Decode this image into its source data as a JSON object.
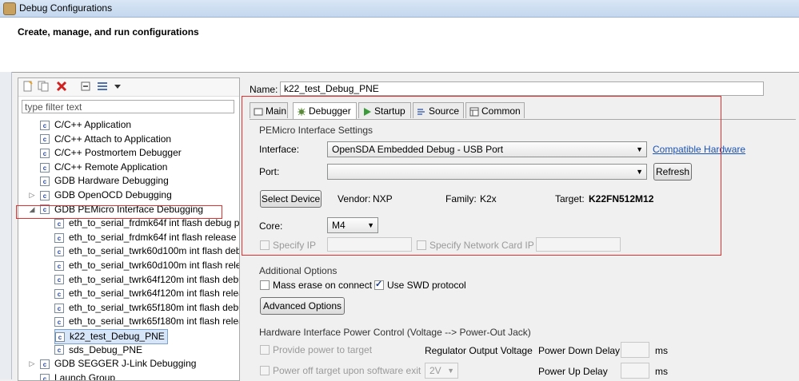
{
  "window": {
    "title": "Debug Configurations"
  },
  "header": {
    "heading": "Create, manage, and run configurations"
  },
  "sidebar": {
    "filter_placeholder": "type filter text",
    "items": [
      {
        "label": "C/C++ Application",
        "level": 0,
        "expander": ""
      },
      {
        "label": "C/C++ Attach to Application",
        "level": 0,
        "expander": ""
      },
      {
        "label": "C/C++ Postmortem Debugger",
        "level": 0,
        "expander": ""
      },
      {
        "label": "C/C++ Remote Application",
        "level": 0,
        "expander": ""
      },
      {
        "label": "GDB Hardware Debugging",
        "level": 0,
        "expander": ""
      },
      {
        "label": "GDB OpenOCD Debugging",
        "level": 0,
        "expander": "▷"
      },
      {
        "label": "GDB PEMicro Interface Debugging",
        "level": 0,
        "expander": "◢"
      },
      {
        "label": "eth_to_serial_frdmk64f int flash debug pne",
        "level": 1,
        "expander": ""
      },
      {
        "label": "eth_to_serial_frdmk64f int flash release pne",
        "level": 1,
        "expander": ""
      },
      {
        "label": "eth_to_serial_twrk60d100m int flash debug pne",
        "level": 1,
        "expander": ""
      },
      {
        "label": "eth_to_serial_twrk60d100m int flash release pne",
        "level": 1,
        "expander": ""
      },
      {
        "label": "eth_to_serial_twrk64f120m int flash debug pne",
        "level": 1,
        "expander": ""
      },
      {
        "label": "eth_to_serial_twrk64f120m int flash release pne",
        "level": 1,
        "expander": ""
      },
      {
        "label": "eth_to_serial_twrk65f180m int flash debug pne",
        "level": 1,
        "expander": ""
      },
      {
        "label": "eth_to_serial_twrk65f180m int flash release pne",
        "level": 1,
        "expander": ""
      },
      {
        "label": "k22_test_Debug_PNE",
        "level": 1,
        "expander": "",
        "selected": true
      },
      {
        "label": "sds_Debug_PNE",
        "level": 1,
        "expander": ""
      },
      {
        "label": "GDB SEGGER J-Link Debugging",
        "level": 0,
        "expander": "▷"
      },
      {
        "label": "Launch Group",
        "level": 0,
        "expander": ""
      }
    ]
  },
  "main": {
    "name_label": "Name:",
    "name_value": "k22_test_Debug_PNE",
    "tabs": [
      "Main",
      "Debugger",
      "Startup",
      "Source",
      "Common"
    ],
    "pemicro": {
      "section_title": "PEMicro Interface Settings",
      "interface_label": "Interface:",
      "interface_value": "OpenSDA Embedded Debug - USB Port",
      "compatible_link": "Compatible Hardware",
      "port_label": "Port:",
      "port_value": "",
      "refresh_label": "Refresh",
      "select_device_label": "Select Device",
      "vendor_label": "Vendor:",
      "vendor_value": "NXP",
      "family_label": "Family:",
      "family_value": "K2x",
      "target_label": "Target:",
      "target_value": "K22FN512M12",
      "core_label": "Core:",
      "core_value": "M4",
      "specify_ip_label": "Specify IP",
      "specify_network_label": "Specify Network Card IP"
    },
    "additional": {
      "section_title": "Additional Options",
      "mass_erase_label": "Mass erase on connect",
      "use_swd_label": "Use SWD protocol",
      "advanced_label": "Advanced Options"
    },
    "power": {
      "section_title": "Hardware Interface Power Control (Voltage --> Power-Out Jack)",
      "provide_power_label": "Provide power to target",
      "regulator_label": "Regulator Output Voltage",
      "power_down_label": "Power Down Delay",
      "ms1": "ms",
      "power_off_label": "Power off target upon software exit",
      "voltage_value": "2V",
      "power_up_label": "Power Up Delay",
      "ms2": "ms"
    }
  },
  "colors": {
    "annotation_red": "#e03030",
    "link_blue": "#1a53b3",
    "selection": "#d7e5f8"
  }
}
